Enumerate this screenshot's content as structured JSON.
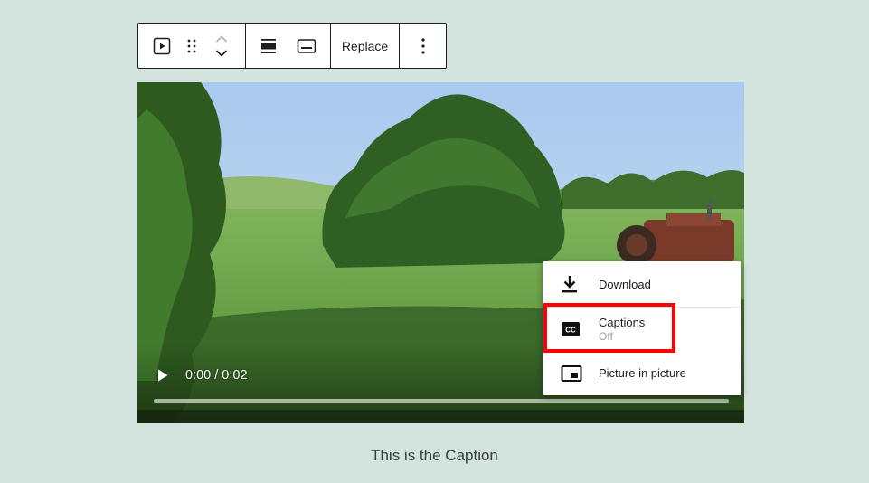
{
  "toolbar": {
    "replace_label": "Replace"
  },
  "video": {
    "time_display": "0:00 / 0:02",
    "progress": 0
  },
  "menu": {
    "download_label": "Download",
    "captions_label": "Captions",
    "captions_state": "Off",
    "pip_label": "Picture in picture"
  },
  "caption": {
    "text": "This is the Caption"
  },
  "colors": {
    "background": "#d3e4de",
    "highlight": "#ff0000"
  }
}
